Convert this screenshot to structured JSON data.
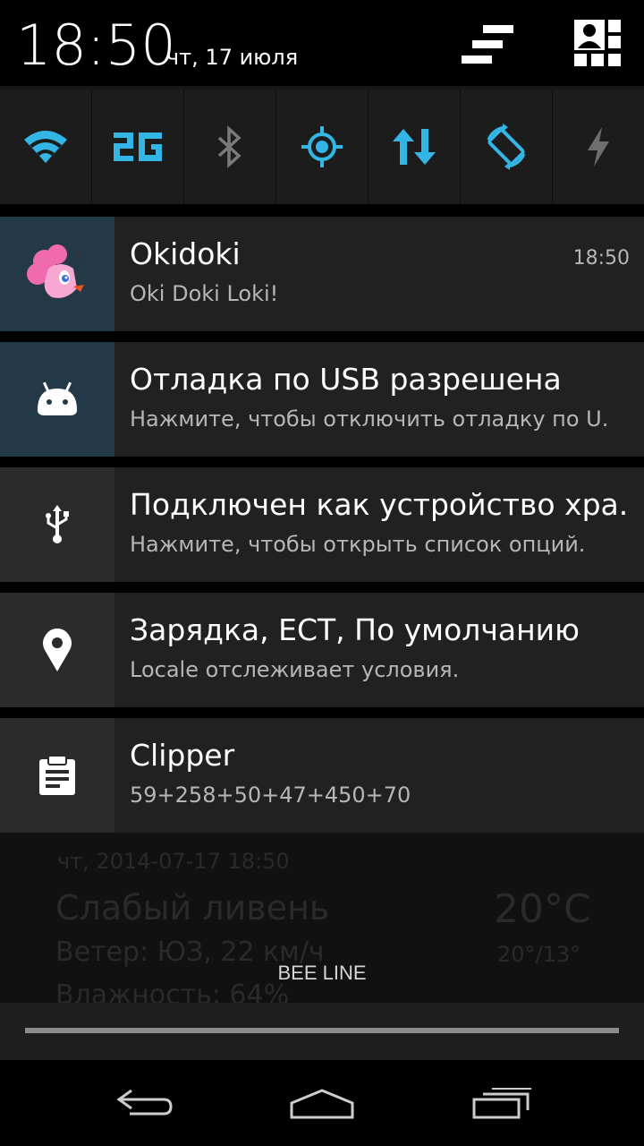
{
  "header": {
    "time": "18:50",
    "date": "чт, 17 июля"
  },
  "toggles": [
    {
      "name": "wifi",
      "icon": "wifi-icon"
    },
    {
      "name": "mobile-data-2g",
      "icon": "2g-icon",
      "label": "2G"
    },
    {
      "name": "bluetooth",
      "icon": "bluetooth-icon"
    },
    {
      "name": "location",
      "icon": "location-target-icon"
    },
    {
      "name": "data-sync",
      "icon": "sync-arrows-icon"
    },
    {
      "name": "auto-rotate",
      "icon": "rotate-icon"
    },
    {
      "name": "flashlight",
      "icon": "flash-icon"
    }
  ],
  "notifications": [
    {
      "title": "Okidoki",
      "text": "Oki Doki Loki!",
      "time": "18:50",
      "icon": "pony-avatar-icon"
    },
    {
      "title": "Отладка по USB разрешена",
      "text": "Нажмите, чтобы отключить отладку по U.",
      "icon": "android-debug-icon"
    },
    {
      "title": "Подключен как устройство хра.",
      "text": "Нажмите, чтобы открыть список опций.",
      "icon": "usb-icon"
    },
    {
      "title": "Зарядка, ЕСТ, По умолчанию",
      "text": "Locale отслеживает условия.",
      "icon": "location-pin-icon"
    },
    {
      "title": "Clipper",
      "text": "59+258+50+47+450+70",
      "icon": "clipboard-icon"
    }
  ],
  "background_widget": {
    "date_line": "чт, 2014-07-17 18:50",
    "condition": "Слабый ливень",
    "wind": "Ветер: ЮЗ, 22 км/ч",
    "humidity": "Влажность: 64%",
    "temp": "20°C",
    "range": "20°/13°"
  },
  "carrier": "BEE LINE",
  "colors": {
    "accent": "#33b5e5",
    "toggle_bg": "#1c1c1c",
    "notif_bg": "#212121",
    "icon_tint_bg": "#233947"
  }
}
